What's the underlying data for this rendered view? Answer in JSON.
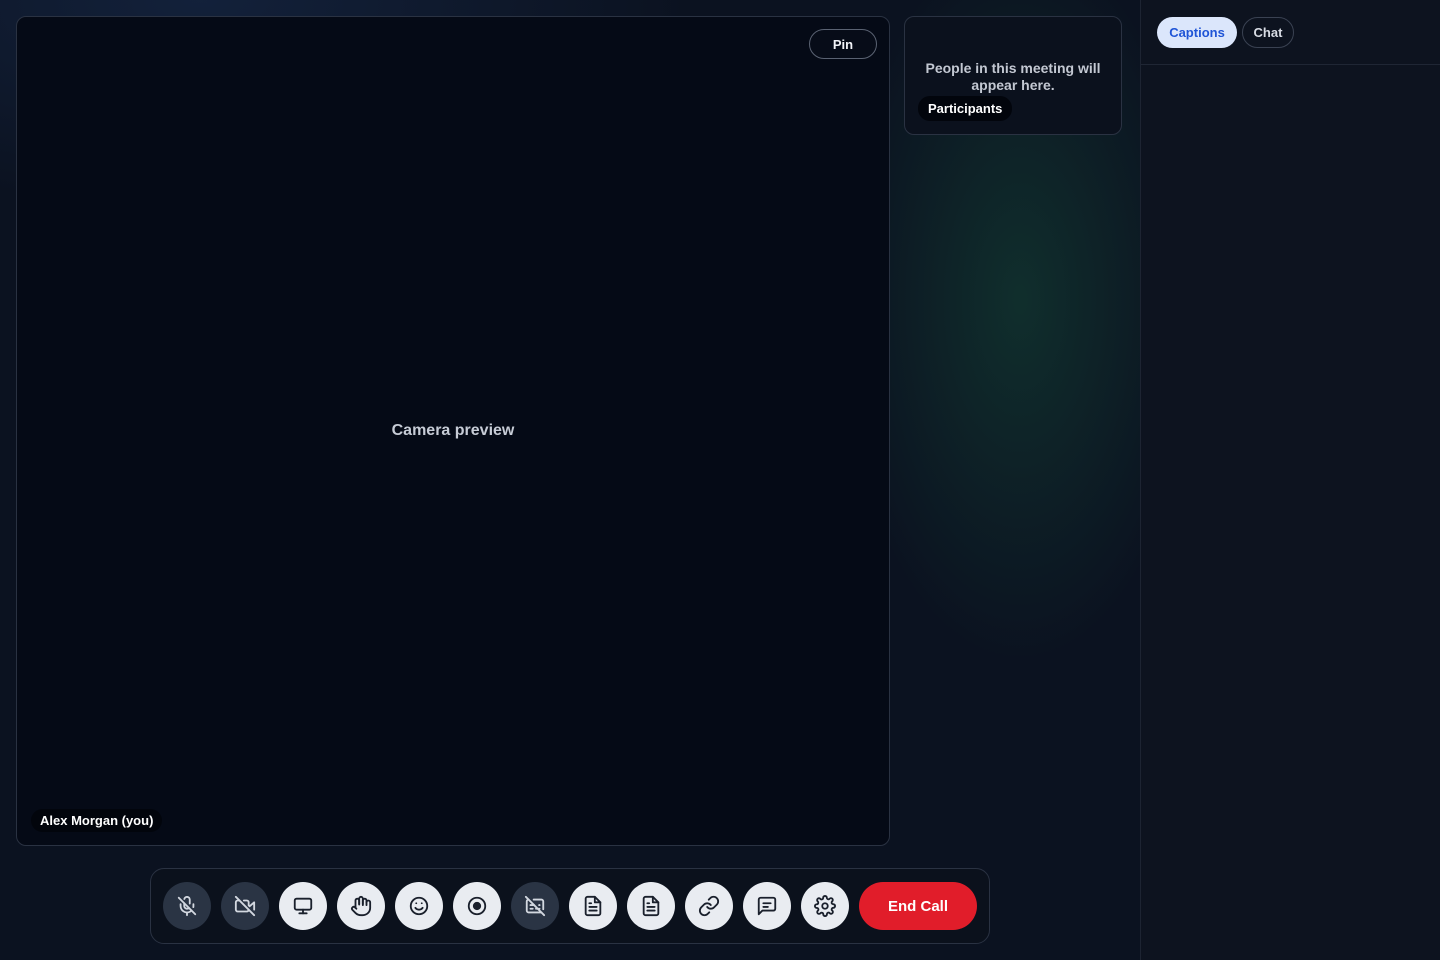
{
  "stage": {
    "pin_label": "Pin",
    "camera_preview_text": "Camera preview",
    "self_name": "Alex Morgan (you)"
  },
  "participants": {
    "empty_text": "People in this meeting will appear here.",
    "label": "Participants"
  },
  "side_panel": {
    "tabs": [
      {
        "label": "Captions",
        "active": true
      },
      {
        "label": "Chat",
        "active": false
      }
    ]
  },
  "toolbar": {
    "buttons": [
      {
        "icon": "mic-off-icon",
        "state": "off"
      },
      {
        "icon": "video-off-icon",
        "state": "off"
      },
      {
        "icon": "screen-share-icon",
        "state": "on"
      },
      {
        "icon": "raise-hand-icon",
        "state": "on"
      },
      {
        "icon": "emoji-icon",
        "state": "on"
      },
      {
        "icon": "record-icon",
        "state": "on"
      },
      {
        "icon": "captions-off-icon",
        "state": "off"
      },
      {
        "icon": "document-icon",
        "state": "on"
      },
      {
        "icon": "notes-icon",
        "state": "on"
      },
      {
        "icon": "link-icon",
        "state": "on"
      },
      {
        "icon": "chat-icon",
        "state": "on"
      },
      {
        "icon": "settings-icon",
        "state": "on"
      }
    ],
    "end_call_label": "End Call"
  },
  "colors": {
    "background": "#0b1220",
    "stage": "#050a16",
    "active_tab_bg": "#dbe6fb",
    "active_tab_text": "#1f54d6",
    "end_call": "#e11d2a"
  }
}
